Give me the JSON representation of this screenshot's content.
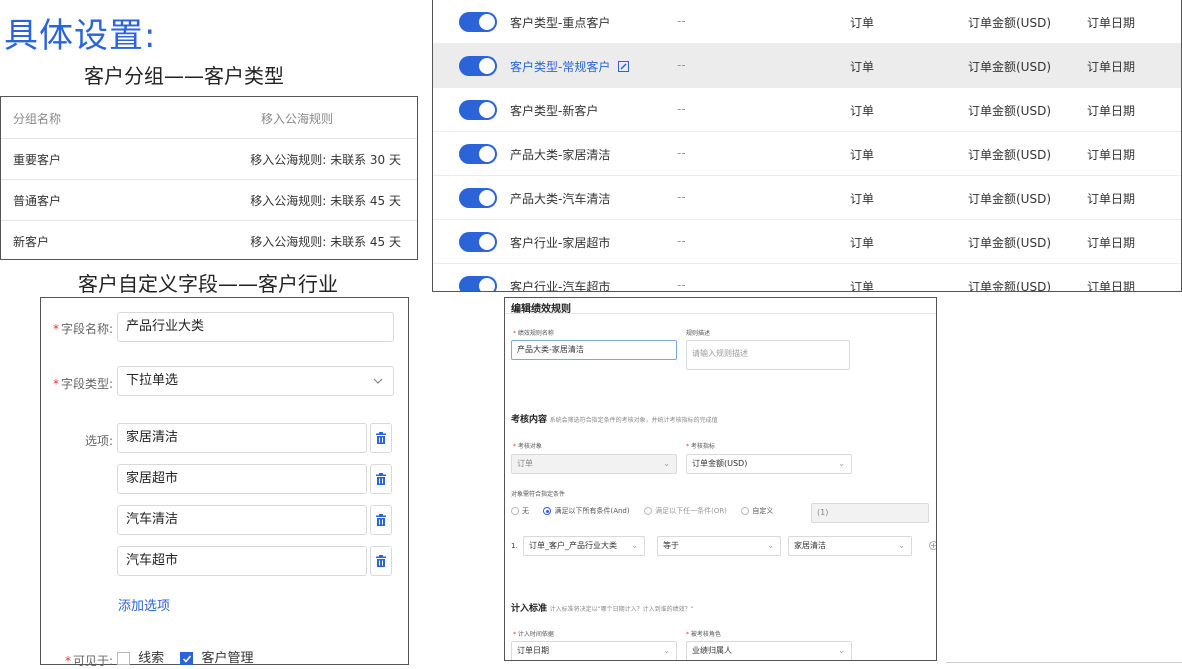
{
  "page": {
    "title": "具体设置:",
    "group_subtitle": "客户分组——客户类型",
    "field_subtitle": "客户自定义字段——客户行业"
  },
  "group_table": {
    "headers": [
      "分组名称",
      "移入公海规则"
    ],
    "rows": [
      {
        "name": "重要客户",
        "rule": "移入公海规则: 未联系 30 天"
      },
      {
        "name": "普通客户",
        "rule": "移入公海规则: 未联系 45 天"
      },
      {
        "name": "新客户",
        "rule": "移入公海规则: 未联系 45 天"
      }
    ]
  },
  "field_form": {
    "name_label": "字段名称:",
    "name_value": "产品行业大类",
    "type_label": "字段类型:",
    "type_value": "下拉单选",
    "options_label": "选项:",
    "options": [
      "家居清洁",
      "家居超市",
      "汽车清洁",
      "汽车超市"
    ],
    "add_option": "添加选项",
    "visible_label": "可见于:",
    "visible_opt1": "线索",
    "visible_opt2": "客户管理"
  },
  "rules_table": {
    "rows": [
      {
        "name": "客户类型-重点客户",
        "desc": "--",
        "object": "订单",
        "indicator": "订单金额(USD)",
        "date": "订单日期",
        "enabled": true
      },
      {
        "name": "客户类型-常规客户",
        "desc": "--",
        "object": "订单",
        "indicator": "订单金额(USD)",
        "date": "订单日期",
        "enabled": true,
        "highlighted": true
      },
      {
        "name": "客户类型-新客户",
        "desc": "--",
        "object": "订单",
        "indicator": "订单金额(USD)",
        "date": "订单日期",
        "enabled": true
      },
      {
        "name": "产品大类-家居清洁",
        "desc": "--",
        "object": "订单",
        "indicator": "订单金额(USD)",
        "date": "订单日期",
        "enabled": true
      },
      {
        "name": "产品大类-汽车清洁",
        "desc": "--",
        "object": "订单",
        "indicator": "订单金额(USD)",
        "date": "订单日期",
        "enabled": true
      },
      {
        "name": "客户行业-家居超市",
        "desc": "--",
        "object": "订单",
        "indicator": "订单金额(USD)",
        "date": "订单日期",
        "enabled": true
      },
      {
        "name": "客户行业-汽车超市",
        "desc": "--",
        "object": "订单",
        "indicator": "订单金额(USD)",
        "date": "订单日期",
        "enabled": true
      }
    ]
  },
  "edit_form": {
    "title": "编辑绩效规则",
    "rule_name_label": "绩效规则名称",
    "rule_name_value": "产品大类-家居清洁",
    "rule_desc_label": "规则描述",
    "rule_desc_placeholder": "请输入规则描述",
    "section_content": "考核内容",
    "section_content_hint": "系统会筛选符合指定条件的考核对象，并统计考核指标的完成值",
    "object_label": "考核对象",
    "object_value": "订单",
    "indicator_label": "考核指标",
    "indicator_value": "订单金额(USD)",
    "condition_label": "对象需符合指定条件",
    "cond_none": "无",
    "cond_and": "满足以下所有条件(And)",
    "cond_or": "满足以下任一条件(OR)",
    "cond_custom": "自定义",
    "cond_custom_value": "(1)",
    "cond_index": "1.",
    "cond_field": "订单_客户_产品行业大类",
    "cond_op": "等于",
    "cond_value": "家居清洁",
    "section_standard": "计入标准",
    "section_standard_hint": "计入标准将决定以“哪个日期计入？计入到谁的绩效？”",
    "time_basis_label": "计入时间依据",
    "time_basis_value": "订单日期",
    "role_label": "被考核角色",
    "role_value": "业绩归属人"
  }
}
